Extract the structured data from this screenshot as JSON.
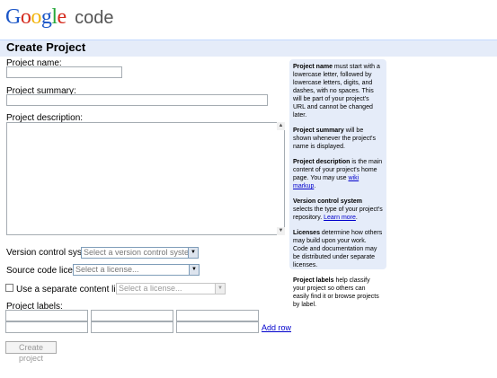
{
  "header": {
    "logo_letters": [
      "G",
      "o",
      "o",
      "g",
      "l",
      "e"
    ],
    "logo_colors": [
      "#1a55c7",
      "#d52b1e",
      "#f2b50f",
      "#1a55c7",
      "#27a83c",
      "#d52b1e"
    ],
    "logo_product": "code",
    "page_title": "Create Project"
  },
  "form": {
    "project_name_label": "Project name:",
    "project_name_value": "",
    "project_summary_label": "Project summary:",
    "project_summary_value": "",
    "project_description_label": "Project description:",
    "project_description_value": "",
    "vcs_label": "Version control system:",
    "vcs_selected": "Select a version control system...",
    "license_label": "Source code license:",
    "license_selected": "Select a license...",
    "content_license_checkbox_label": "Use a separate content license:",
    "content_license_checked": false,
    "content_license_selected": "Select a license...",
    "labels_label": "Project labels:",
    "label_values": [
      "",
      "",
      "",
      "",
      "",
      ""
    ],
    "add_row_link": "Add row",
    "create_button": "Create project"
  },
  "help": {
    "name": {
      "term": "Project name",
      "text": " must start with a lowercase letter, followed by lowercase letters, digits, and dashes, with no spaces. This will be part of your project's URL and cannot be changed later."
    },
    "summary": {
      "term": "Project summary",
      "text": " will be shown whenever the project's name is displayed."
    },
    "description": {
      "term": "Project description",
      "text": " is the main content of your project's home page. You may use ",
      "link": "wiki markup",
      "after": "."
    },
    "vcs": {
      "term": "Version control system",
      "text": " selects the type of your project's repository. ",
      "link": "Learn more",
      "after": "."
    },
    "licenses": {
      "term": "Licenses",
      "text": " determine how others may build upon your work. Code and documentation may be distributed under separate licenses."
    },
    "labels": {
      "term": "Project labels",
      "text": " help classify your project so others can easily find it or browse projects by label."
    }
  }
}
